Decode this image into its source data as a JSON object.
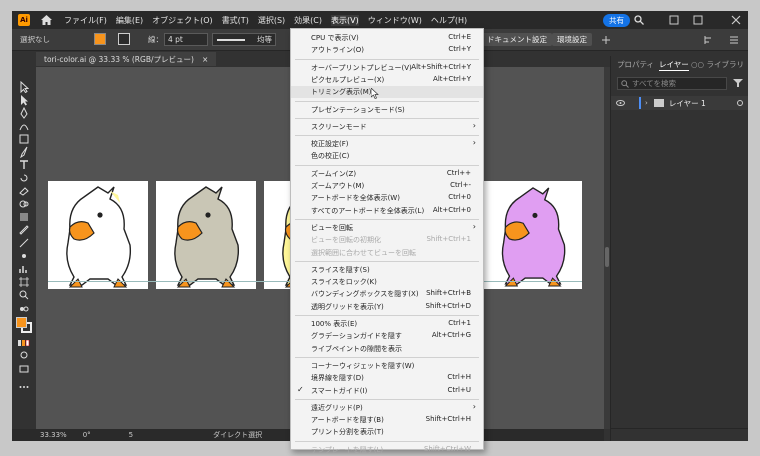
{
  "menubar": {
    "items": [
      "ファイル(F)",
      "編集(E)",
      "オブジェクト(O)",
      "書式(T)",
      "選択(S)",
      "効果(C)",
      "表示(V)",
      "ウィンドウ(W)",
      "ヘルプ(H)"
    ],
    "share": "共有",
    "app_logo": "Ai"
  },
  "control": {
    "selection": "選択なし",
    "stroke_label": "線：",
    "stroke_value": "4 pt",
    "stroke_style": "均等",
    "doc_settings": "ドキュメント設定",
    "prefs": "環境設定"
  },
  "document": {
    "tab": "tori-color.ai @ 33.33 % (RGB/プレビュー)",
    "close": "×"
  },
  "panel": {
    "tabs": [
      "プロパティ",
      "レイヤー",
      "○○ ライブラリ"
    ],
    "search_placeholder": "すべてを検索",
    "layer_name": "レイヤー 1"
  },
  "status": {
    "zoom": "33.33%",
    "rotate": "0°",
    "page": "5",
    "tool": "ダイレクト選択"
  },
  "view_menu": {
    "items": [
      {
        "label": "CPU で表示(V)",
        "shortcut": "Ctrl+E"
      },
      {
        "label": "アウトライン(O)",
        "shortcut": "Ctrl+Y"
      },
      {
        "sep": true
      },
      {
        "label": "オーバープリントプレビュー(V)",
        "shortcut": "Alt+Shift+Ctrl+Y"
      },
      {
        "label": "ピクセルプレビュー(X)",
        "shortcut": "Alt+Ctrl+Y"
      },
      {
        "label": "トリミング表示(M)",
        "shortcut": "",
        "hover": true
      },
      {
        "sep": true
      },
      {
        "label": "プレゼンテーションモード(S)",
        "shortcut": ""
      },
      {
        "sep": true
      },
      {
        "label": "スクリーンモード",
        "shortcut": "",
        "submenu": true
      },
      {
        "sep": true
      },
      {
        "label": "校正設定(F)",
        "shortcut": "",
        "submenu": true
      },
      {
        "label": "色の校正(C)",
        "shortcut": ""
      },
      {
        "sep": true
      },
      {
        "label": "ズームイン(Z)",
        "shortcut": "Ctrl++"
      },
      {
        "label": "ズームアウト(M)",
        "shortcut": "Ctrl+-"
      },
      {
        "label": "アートボードを全体表示(W)",
        "shortcut": "Ctrl+0"
      },
      {
        "label": "すべてのアートボードを全体表示(L)",
        "shortcut": "Alt+Ctrl+0"
      },
      {
        "sep": true
      },
      {
        "label": "ビューを回転",
        "shortcut": "",
        "submenu": true
      },
      {
        "label": "ビューを回転の初期化",
        "shortcut": "Shift+Ctrl+1",
        "disabled": true
      },
      {
        "label": "選択範囲に合わせてビューを回転",
        "shortcut": "",
        "disabled": true
      },
      {
        "sep": true
      },
      {
        "label": "スライスを隠す(S)",
        "shortcut": ""
      },
      {
        "label": "スライスをロック(K)",
        "shortcut": ""
      },
      {
        "label": "バウンディングボックスを隠す(X)",
        "shortcut": "Shift+Ctrl+B"
      },
      {
        "label": "透明グリッドを表示(Y)",
        "shortcut": "Shift+Ctrl+D"
      },
      {
        "sep": true
      },
      {
        "label": "100% 表示(E)",
        "shortcut": "Ctrl+1"
      },
      {
        "label": "グラデーションガイドを隠す",
        "shortcut": "Alt+Ctrl+G"
      },
      {
        "label": "ライブペイントの隙間を表示",
        "shortcut": ""
      },
      {
        "sep": true
      },
      {
        "label": "コーナーウィジェットを隠す(W)",
        "shortcut": ""
      },
      {
        "label": "境界線を隠す(D)",
        "shortcut": "Ctrl+H"
      },
      {
        "label": "スマートガイド(I)",
        "shortcut": "Ctrl+U",
        "checked": true
      },
      {
        "sep": true
      },
      {
        "label": "遠近グリッド(P)",
        "shortcut": "",
        "submenu": true
      },
      {
        "label": "アートボードを隠す(B)",
        "shortcut": "Shift+Ctrl+H"
      },
      {
        "label": "プリント分割を表示(T)",
        "shortcut": ""
      },
      {
        "sep": true
      },
      {
        "label": "テンプレートを隠す(L)",
        "shortcut": "Shift+Ctrl+W",
        "disabled": true
      }
    ]
  },
  "colors": {
    "accent": "#1473e6",
    "fill": "#f7941d",
    "bird_white": "#ffffff",
    "bird_gray": "#c9c6b5",
    "bird_yellow": "#fff799",
    "bird_purple": "#e09ef2",
    "beak": "#f7941d"
  }
}
